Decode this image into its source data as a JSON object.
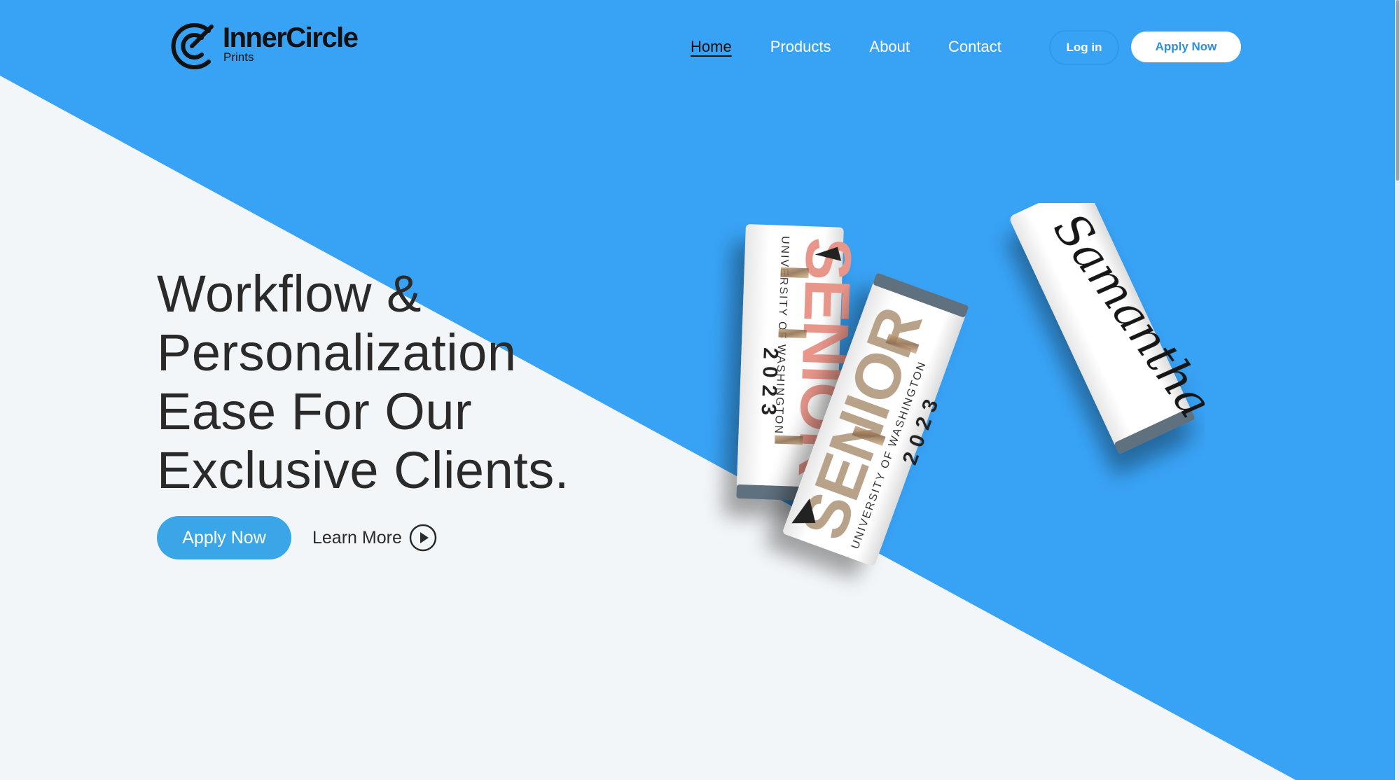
{
  "brand": {
    "name": "InnerCircle",
    "subtitle": "Prints"
  },
  "nav": {
    "items": [
      {
        "label": "Home",
        "active": true
      },
      {
        "label": "Products",
        "active": false
      },
      {
        "label": "About",
        "active": false
      },
      {
        "label": "Contact",
        "active": false
      }
    ],
    "login_label": "Log in",
    "apply_label": "Apply Now"
  },
  "hero": {
    "title_lines": [
      "Workflow &",
      "Personalization",
      "Ease For Our",
      "Exclusive Clients."
    ],
    "apply_label": "Apply Now",
    "learn_more_label": "Learn More"
  },
  "product_image": {
    "tumbler_1": {
      "word": "SENIOR",
      "year": "2023",
      "school": "UNIVERSITY OF WASHINGTON"
    },
    "tumbler_2": {
      "word": "SENIOR",
      "year": "2023",
      "school": "UNIVERSITY OF WASHINGTON"
    },
    "tumbler_3": {
      "name": "Samantha"
    }
  },
  "colors": {
    "accent_blue": "#38a2f5",
    "hero_button": "#3aa6e8",
    "light_bg": "#f3f6f9",
    "text_dark": "#2a2a2a"
  }
}
